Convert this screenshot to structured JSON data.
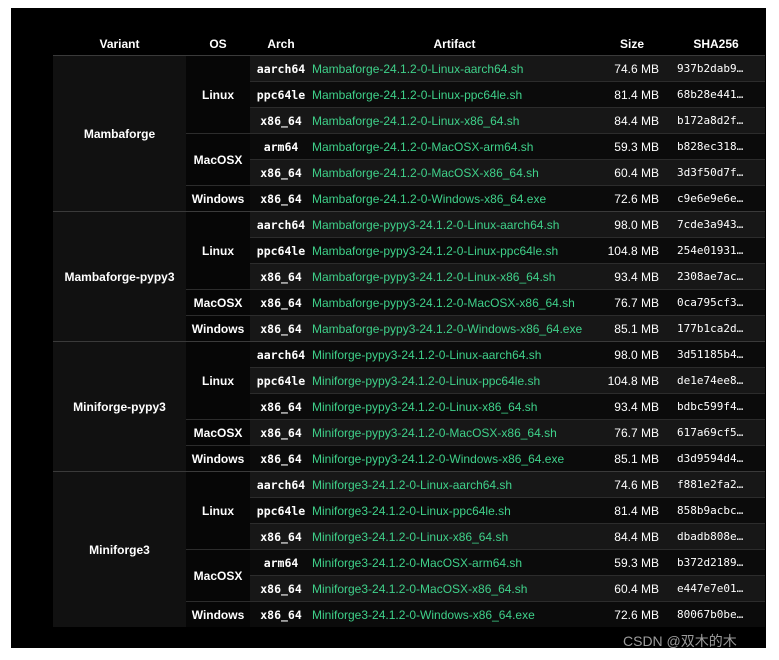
{
  "headers": {
    "variant": "Variant",
    "os": "OS",
    "arch": "Arch",
    "artifact": "Artifact",
    "size": "Size",
    "sha256": "SHA256"
  },
  "groups": [
    {
      "variant": "Mambaforge",
      "os_groups": [
        {
          "os": "Linux",
          "rows": [
            {
              "arch": "aarch64",
              "artifact": "Mambaforge-24.1.2-0-Linux-aarch64.sh",
              "size": "74.6 MB",
              "sha": "937b2dab9…"
            },
            {
              "arch": "ppc64le",
              "artifact": "Mambaforge-24.1.2-0-Linux-ppc64le.sh",
              "size": "81.4 MB",
              "sha": "68b28e441…"
            },
            {
              "arch": "x86_64",
              "artifact": "Mambaforge-24.1.2-0-Linux-x86_64.sh",
              "size": "84.4 MB",
              "sha": "b172a8d2f…"
            }
          ]
        },
        {
          "os": "MacOSX",
          "rows": [
            {
              "arch": "arm64",
              "artifact": "Mambaforge-24.1.2-0-MacOSX-arm64.sh",
              "size": "59.3 MB",
              "sha": "b828ec318…"
            },
            {
              "arch": "x86_64",
              "artifact": "Mambaforge-24.1.2-0-MacOSX-x86_64.sh",
              "size": "60.4 MB",
              "sha": "3d3f50d7f…"
            }
          ]
        },
        {
          "os": "Windows",
          "rows": [
            {
              "arch": "x86_64",
              "artifact": "Mambaforge-24.1.2-0-Windows-x86_64.exe",
              "size": "72.6 MB",
              "sha": "c9e6e9e6e…"
            }
          ]
        }
      ]
    },
    {
      "variant": "Mambaforge-pypy3",
      "os_groups": [
        {
          "os": "Linux",
          "rows": [
            {
              "arch": "aarch64",
              "artifact": "Mambaforge-pypy3-24.1.2-0-Linux-aarch64.sh",
              "size": "98.0 MB",
              "sha": "7cde3a943…"
            },
            {
              "arch": "ppc64le",
              "artifact": "Mambaforge-pypy3-24.1.2-0-Linux-ppc64le.sh",
              "size": "104.8 MB",
              "sha": "254e01931…"
            },
            {
              "arch": "x86_64",
              "artifact": "Mambaforge-pypy3-24.1.2-0-Linux-x86_64.sh",
              "size": "93.4 MB",
              "sha": "2308ae7ac…"
            }
          ]
        },
        {
          "os": "MacOSX",
          "rows": [
            {
              "arch": "x86_64",
              "artifact": "Mambaforge-pypy3-24.1.2-0-MacOSX-x86_64.sh",
              "size": "76.7 MB",
              "sha": "0ca795cf3…"
            }
          ]
        },
        {
          "os": "Windows",
          "rows": [
            {
              "arch": "x86_64",
              "artifact": "Mambaforge-pypy3-24.1.2-0-Windows-x86_64.exe",
              "size": "85.1 MB",
              "sha": "177b1ca2d…"
            }
          ]
        }
      ]
    },
    {
      "variant": "Miniforge-pypy3",
      "os_groups": [
        {
          "os": "Linux",
          "rows": [
            {
              "arch": "aarch64",
              "artifact": "Miniforge-pypy3-24.1.2-0-Linux-aarch64.sh",
              "size": "98.0 MB",
              "sha": "3d51185b4…"
            },
            {
              "arch": "ppc64le",
              "artifact": "Miniforge-pypy3-24.1.2-0-Linux-ppc64le.sh",
              "size": "104.8 MB",
              "sha": "de1e74ee8…"
            },
            {
              "arch": "x86_64",
              "artifact": "Miniforge-pypy3-24.1.2-0-Linux-x86_64.sh",
              "size": "93.4 MB",
              "sha": "bdbc599f4…"
            }
          ]
        },
        {
          "os": "MacOSX",
          "rows": [
            {
              "arch": "x86_64",
              "artifact": "Miniforge-pypy3-24.1.2-0-MacOSX-x86_64.sh",
              "size": "76.7 MB",
              "sha": "617a69cf5…"
            }
          ]
        },
        {
          "os": "Windows",
          "rows": [
            {
              "arch": "x86_64",
              "artifact": "Miniforge-pypy3-24.1.2-0-Windows-x86_64.exe",
              "size": "85.1 MB",
              "sha": "d3d9594d4…"
            }
          ]
        }
      ]
    },
    {
      "variant": "Miniforge3",
      "os_groups": [
        {
          "os": "Linux",
          "rows": [
            {
              "arch": "aarch64",
              "artifact": "Miniforge3-24.1.2-0-Linux-aarch64.sh",
              "size": "74.6 MB",
              "sha": "f881e2fa2…"
            },
            {
              "arch": "ppc64le",
              "artifact": "Miniforge3-24.1.2-0-Linux-ppc64le.sh",
              "size": "81.4 MB",
              "sha": "858b9acbc…"
            },
            {
              "arch": "x86_64",
              "artifact": "Miniforge3-24.1.2-0-Linux-x86_64.sh",
              "size": "84.4 MB",
              "sha": "dbadb808e…"
            }
          ]
        },
        {
          "os": "MacOSX",
          "rows": [
            {
              "arch": "arm64",
              "artifact": "Miniforge3-24.1.2-0-MacOSX-arm64.sh",
              "size": "59.3 MB",
              "sha": "b372d2189…"
            },
            {
              "arch": "x86_64",
              "artifact": "Miniforge3-24.1.2-0-MacOSX-x86_64.sh",
              "size": "60.4 MB",
              "sha": "e447e7e01…"
            }
          ]
        },
        {
          "os": "Windows",
          "rows": [
            {
              "arch": "x86_64",
              "artifact": "Miniforge3-24.1.2-0-Windows-x86_64.exe",
              "size": "72.6 MB",
              "sha": "80067b0be…"
            }
          ]
        }
      ]
    }
  ],
  "watermark": "CSDN @双木的木",
  "colors": {
    "background": "#000000",
    "link": "#3fd18a",
    "text": "#ffffff"
  }
}
